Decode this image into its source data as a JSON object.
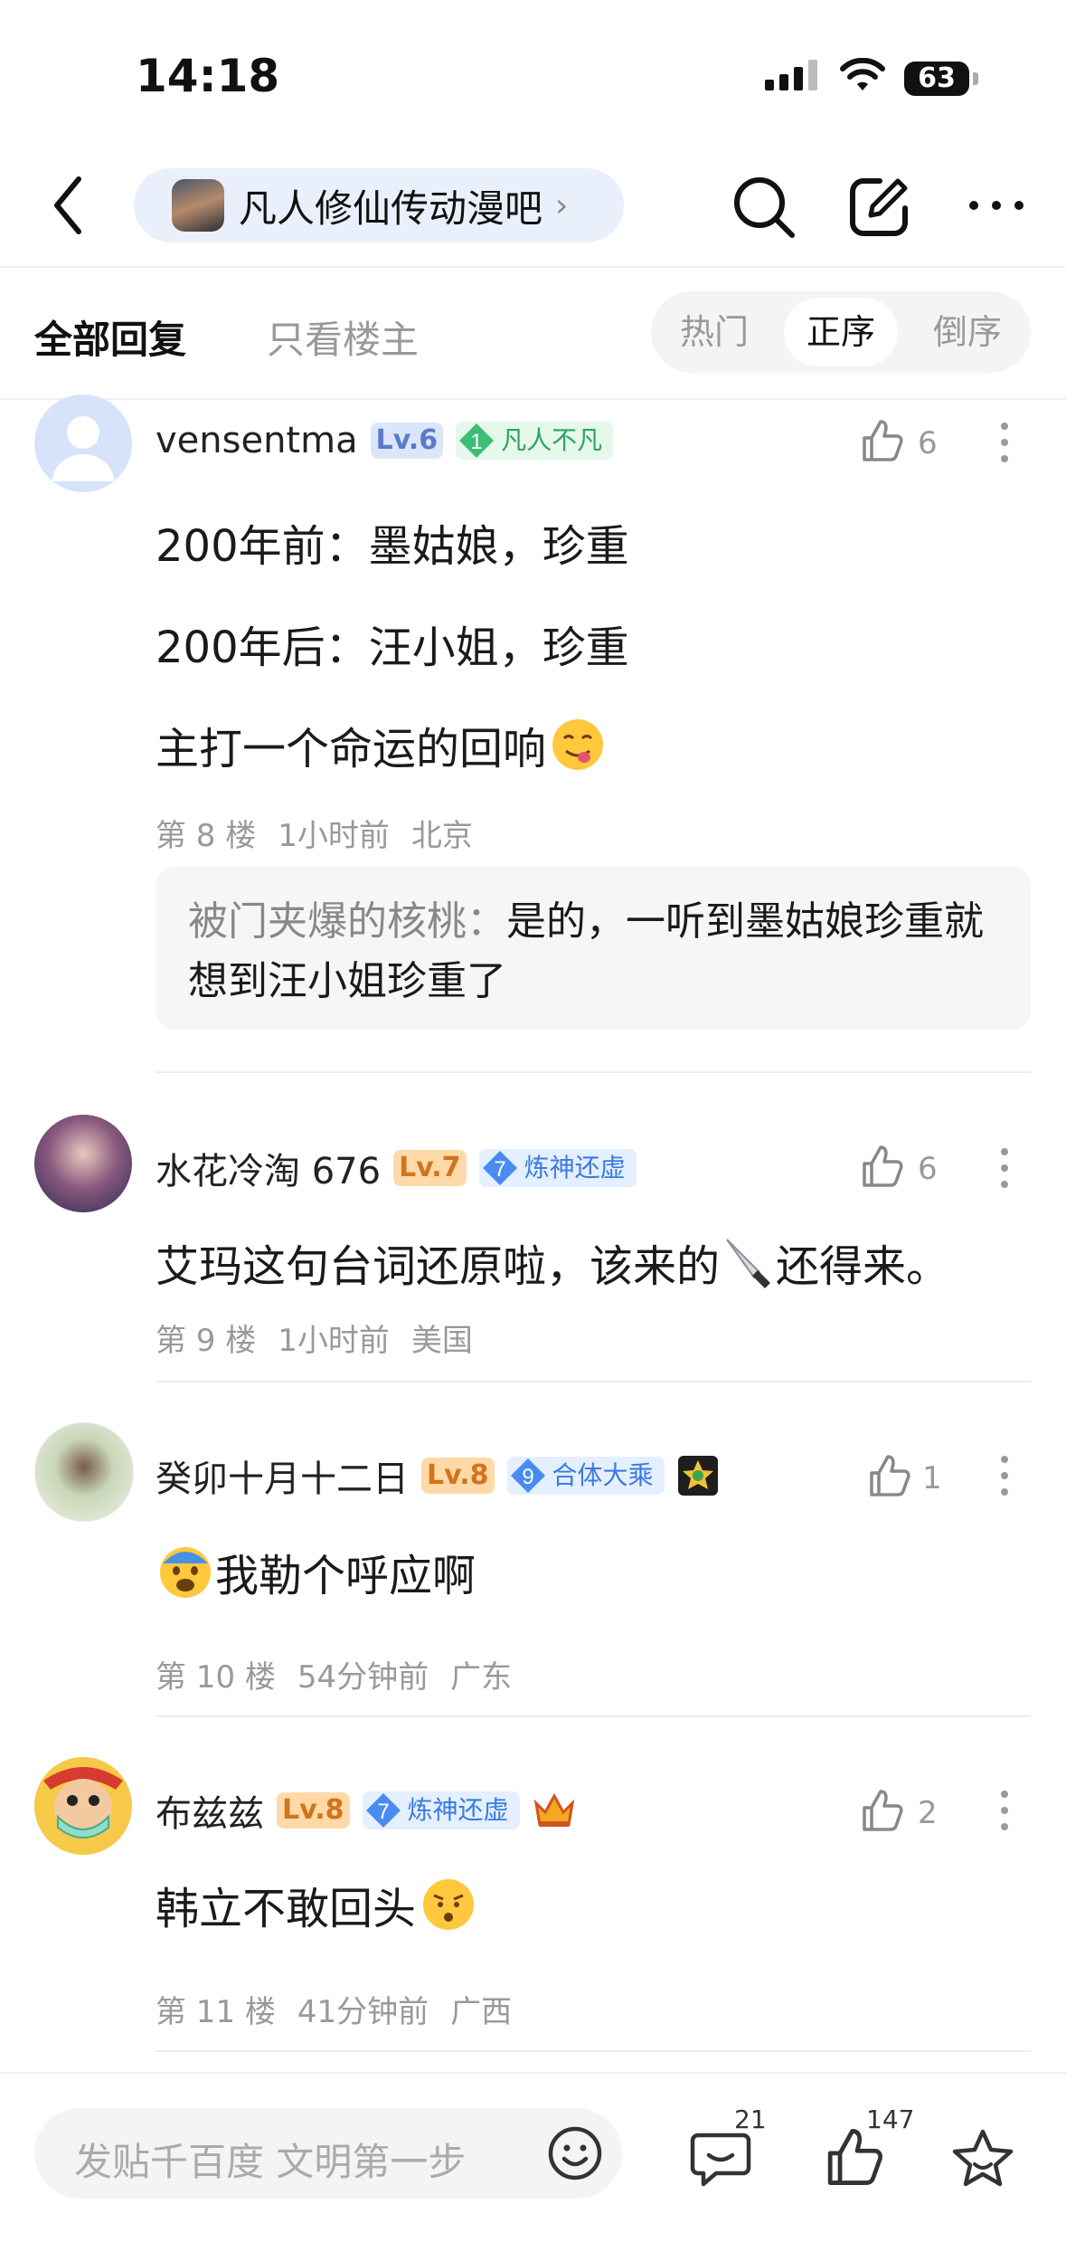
{
  "status_bar": {
    "time": "14:18",
    "battery": "63"
  },
  "header": {
    "forum_name": "凡人修仙传动漫吧"
  },
  "filters": {
    "all_replies": "全部回复",
    "op_only": "只看楼主",
    "sort": [
      "热门",
      "正序",
      "倒序"
    ],
    "sort_active": "正序"
  },
  "posts": [
    {
      "username": "vensentma",
      "level": "Lv.6",
      "title_num": "1",
      "title": "凡人不凡",
      "likes": "6",
      "lines": [
        "200年前：墨姑娘，珍重",
        "200年后：汪小姐，珍重",
        "主打一个命运的回响"
      ],
      "floor": "第 8 楼",
      "time": "1小时前",
      "location": "北京",
      "reply": {
        "name": "被门夹爆的核桃：",
        "text": "是的，一听到墨姑娘珍重就想到汪小姐珍重了"
      }
    },
    {
      "username": "水花冷淘 676",
      "level": "Lv.7",
      "title_num": "7",
      "title": "炼神还虚",
      "likes": "6",
      "text_a": "艾玛这句台词还原啦，该来的",
      "text_b": "还得来。",
      "floor": "第 9 楼",
      "time": "1小时前",
      "location": "美国"
    },
    {
      "username": "癸卯十月十二日",
      "level": "Lv.8",
      "title_num": "9",
      "title": "合体大乘",
      "likes": "1",
      "text": "我勒个呼应啊",
      "floor": "第 10 楼",
      "time": "54分钟前",
      "location": "广东"
    },
    {
      "username": "布兹兹",
      "level": "Lv.8",
      "title_num": "7",
      "title": "炼神还虚",
      "likes": "2",
      "text": "韩立不敢回头",
      "floor": "第 11 楼",
      "time": "41分钟前",
      "location": "广西"
    }
  ],
  "bottom_bar": {
    "placeholder": "发贴千百度 文明第一步",
    "comment_count": "21",
    "like_count": "147"
  },
  "colors": {
    "accent": "#3a7be0",
    "level_orange": "#d2741c",
    "green_badge": "#2aa65c"
  }
}
